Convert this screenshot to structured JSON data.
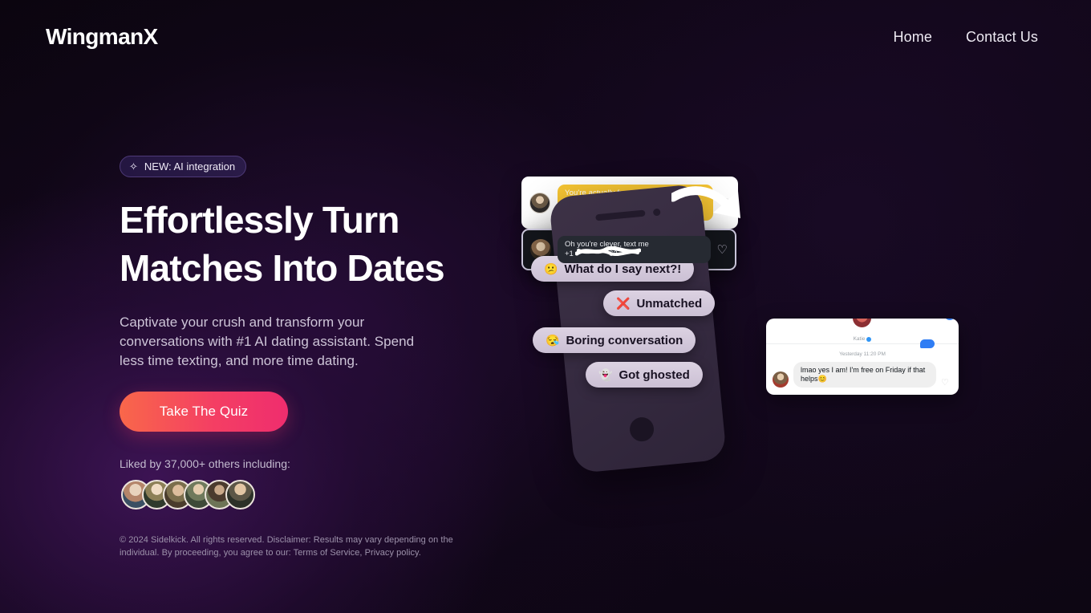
{
  "header": {
    "logo": "WingmanX",
    "nav": [
      {
        "label": "Home"
      },
      {
        "label": "Contact Us"
      }
    ]
  },
  "hero": {
    "badge": {
      "icon": "sparkle",
      "icon_glyph": "✧",
      "label": "NEW: AI integration"
    },
    "headline_line1": "Effortlessly Turn",
    "headline_line2": "Matches Into Dates",
    "subtitle": "Captivate your crush and transform your conversations with #1 AI dating assistant. Spend less time texting, and more time dating.",
    "cta_label": "Take The Quiz",
    "liked_by_label": "Liked by 37,000+ others including:",
    "avatar_count": 6,
    "footer_note": "© 2024 Sidelkick. All rights reserved. Disclaimer: Results may vary depending on the individual. By proceeding, you agree to our: Terms of Service, Privacy policy."
  },
  "visual": {
    "pills": [
      {
        "icon": "😕",
        "label": "What do I say next?!"
      },
      {
        "icon": "❌",
        "label": "Unmatched"
      },
      {
        "icon": "😪",
        "label": "Boring conversation"
      },
      {
        "icon": "👻",
        "label": "Got ghosted"
      }
    ],
    "cards": {
      "tinder": {
        "message": "You're actually funny, haha. Yeah, absolutely, we can meet this weekend. I am free this Sat :))",
        "heart": "♡"
      },
      "instagram": {
        "contact_name": "Katie",
        "timestamp": "Yesterday 11:20 PM",
        "message": "lmao yes I am! I'm free on Friday if that helps😊",
        "heart": "♡"
      },
      "dark": {
        "message_line1": "Oh you're clever, text me",
        "message_prefix": "+1",
        "message_suffix": "63",
        "heart": "♡"
      }
    }
  },
  "colors": {
    "background": "#0a050f",
    "accent_start": "#f9674a",
    "accent_end": "#ef2d6e",
    "badge_border": "#4e3a78",
    "tinder_bubble": "#f6c533",
    "ig_blue": "#2f7df4"
  }
}
